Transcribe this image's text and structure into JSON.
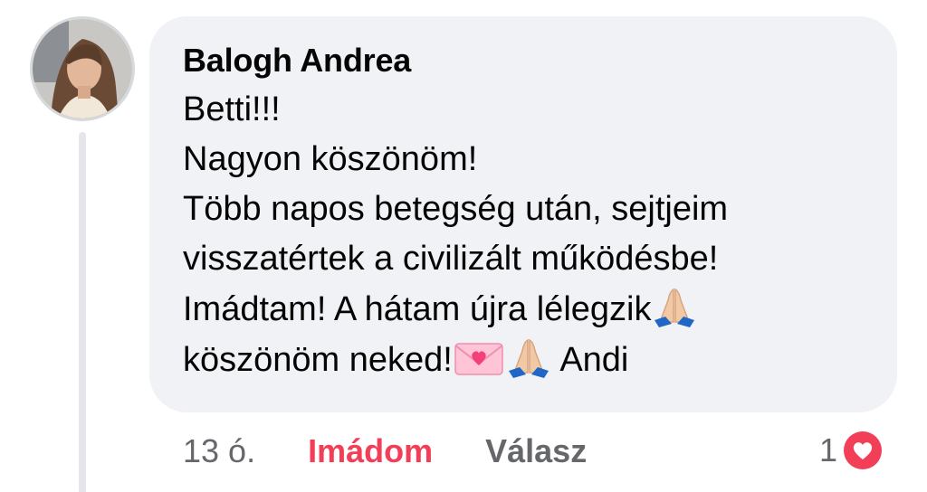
{
  "comment": {
    "author": "Balogh Andrea",
    "lines": [
      "Betti!!!",
      "Nagyon köszönöm!",
      "Több napos betegség után, sejtjeim",
      "visszatértek a civilizált működésbe!",
      "Imádtam! A hátam újra lélegzik",
      "köszönöm neked!",
      "Andi"
    ],
    "emojis": [
      "folded-hands-emoji",
      "love-letter-emoji",
      "folded-hands-emoji"
    ]
  },
  "actions": {
    "timestamp": "13 ó.",
    "reaction_label": "Imádom",
    "reply_label": "Válasz"
  },
  "reactions": {
    "count": "1",
    "icon": "love-reaction-icon",
    "color": "#f33e58"
  },
  "colors": {
    "bubble": "#f0f2f5",
    "text": "#050505",
    "secondary": "#65676b",
    "love": "#f33e58"
  }
}
